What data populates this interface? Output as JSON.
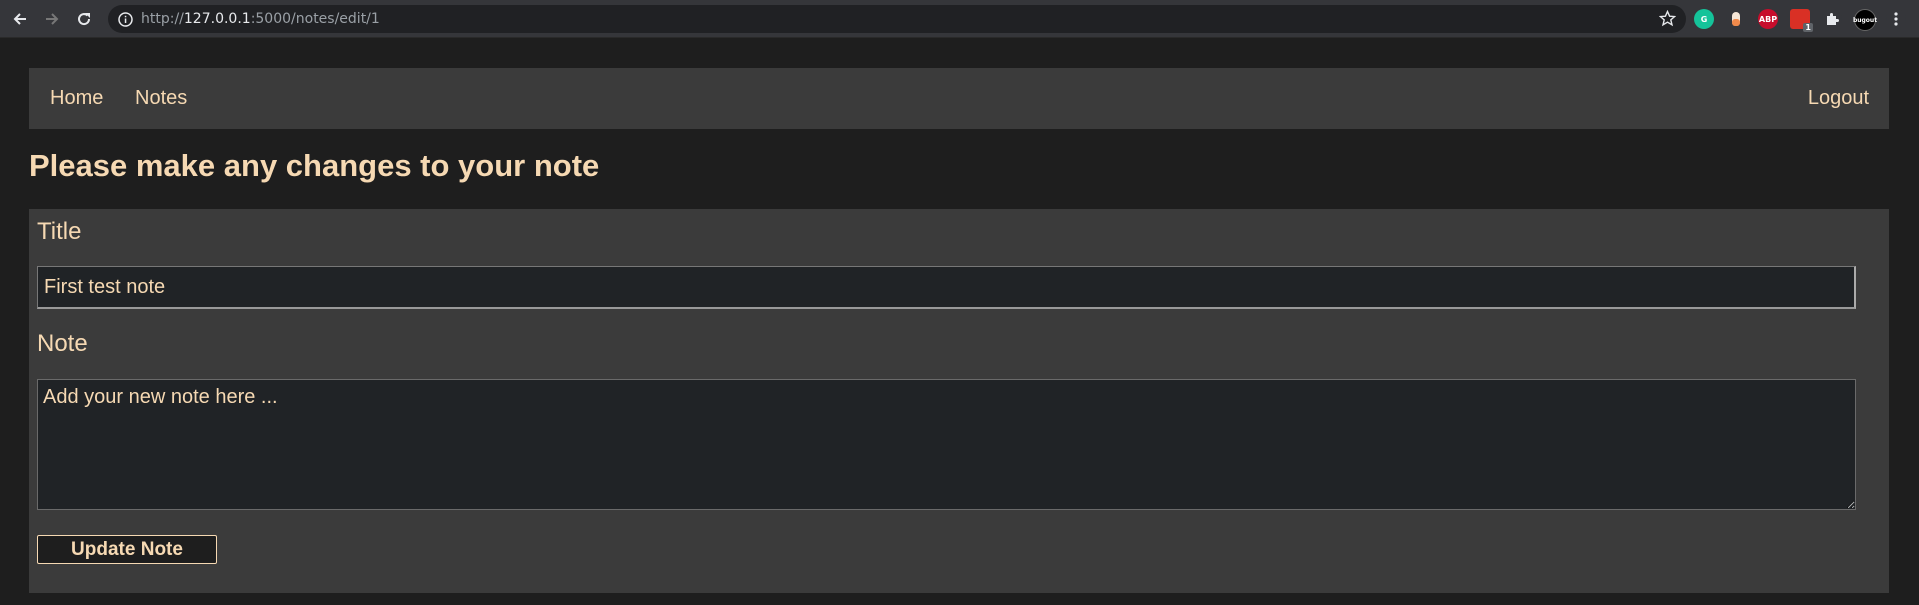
{
  "browser": {
    "url_prefix": "http://",
    "url_host": "127.0.0.1",
    "url_rest": ":5000/notes/edit/1",
    "extensions": [
      {
        "icon": "grammarly-icon",
        "label": "G",
        "color": "#15c39a"
      },
      {
        "icon": "extension-pill-icon",
        "label": "",
        "color": "#f3c29b"
      },
      {
        "icon": "adblock-plus-icon",
        "label": "ABP",
        "color": "#c70d2c"
      },
      {
        "icon": "red-extension-icon",
        "label": "",
        "color": "#d93025"
      },
      {
        "icon": "puzzle-extensions-icon",
        "label": "",
        "color": "#35363a"
      },
      {
        "icon": "profile-avatar-icon",
        "label": "bugout",
        "color": "#000000"
      }
    ],
    "badge_count": "1"
  },
  "nav": {
    "home": "Home",
    "notes": "Notes",
    "logout": "Logout"
  },
  "page": {
    "heading": "Please make any changes to your note"
  },
  "form": {
    "title_label": "Title",
    "title_value": "First test note",
    "note_label": "Note",
    "note_placeholder": "Add your new note here ...",
    "submit_label": "Update Note"
  },
  "colors": {
    "background": "#1e1e1e",
    "panel": "#3b3b3b",
    "text": "#f6d9b3",
    "input_bg": "#202326"
  }
}
